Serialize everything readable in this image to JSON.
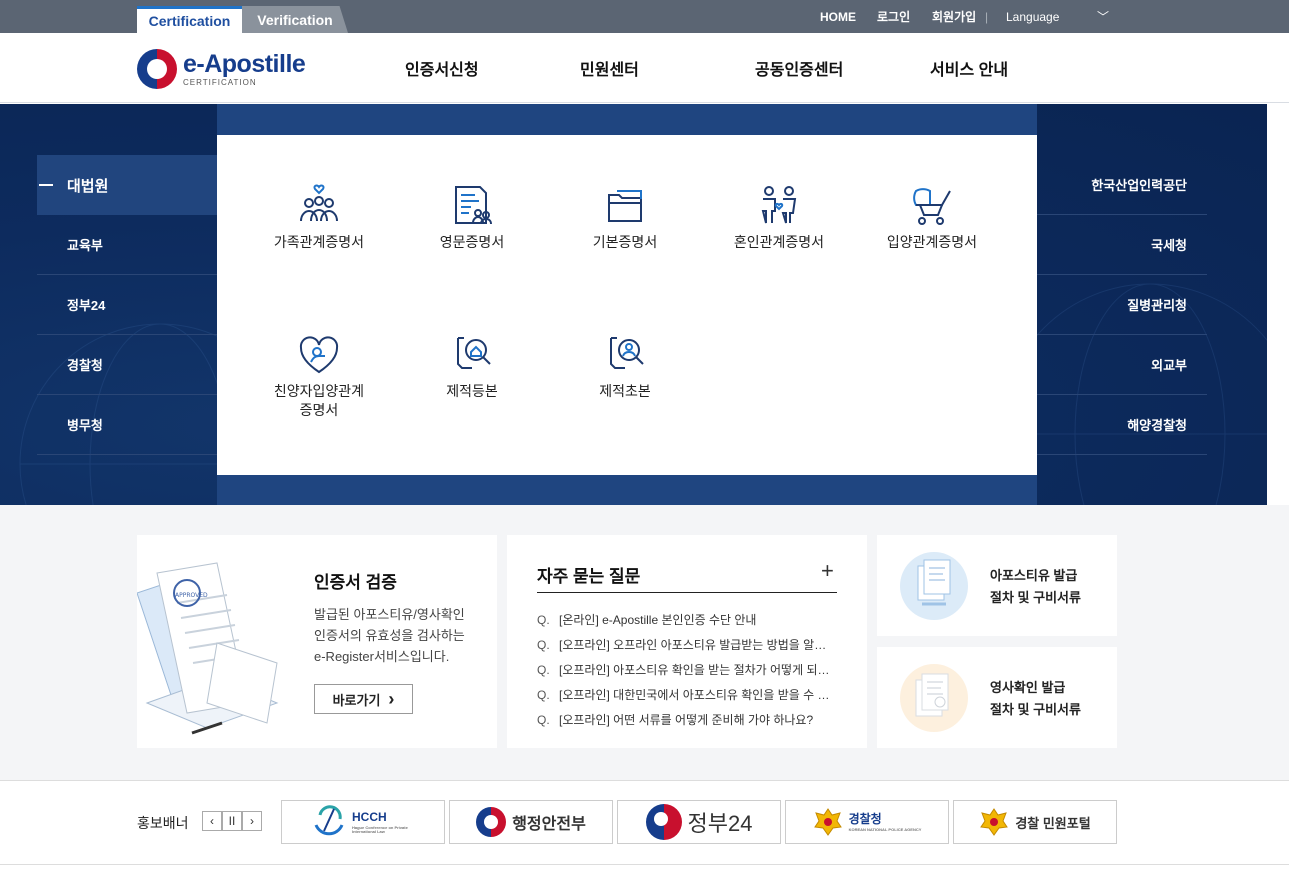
{
  "top_tabs": {
    "certification": "Certification",
    "verification": "Verification"
  },
  "utility": {
    "home": "HOME",
    "login": "로그인",
    "join": "회원가입",
    "separator": "|",
    "language": "Language",
    "caret": "﹀"
  },
  "logo": {
    "name": "e-Apostille",
    "sub": "CERTIFICATION"
  },
  "gnb": [
    "인증서신청",
    "민원센터",
    "공동인증센터",
    "서비스 안내"
  ],
  "left_nav": [
    "대법원",
    "교육부",
    "정부24",
    "경찰청",
    "병무청"
  ],
  "right_nav": [
    "한국산업인력공단",
    "국세청",
    "질병관리청",
    "외교부",
    "해양경찰청"
  ],
  "documents": [
    {
      "label": "가족관계증명서",
      "icon": "family-icon"
    },
    {
      "label": "영문증명서",
      "icon": "english-document-icon"
    },
    {
      "label": "기본증명서",
      "icon": "folder-icon"
    },
    {
      "label": "혼인관계증명서",
      "icon": "couple-icon"
    },
    {
      "label": "입양관계증명서",
      "icon": "stroller-icon"
    },
    {
      "label_line1": "친양자입양관계",
      "label_line2": "증명서",
      "icon": "heart-child-icon"
    },
    {
      "label": "제적등본",
      "icon": "house-search-icon"
    },
    {
      "label": "제적초본",
      "icon": "person-search-icon"
    }
  ],
  "verify": {
    "title": "인증서 검증",
    "desc_line1": "발급된 아포스티유/영사확인",
    "desc_line2": "인증서의 유효성을 검사하는",
    "desc_line3": "e-Register서비스입니다.",
    "button": "바로가기",
    "button_arrow": "›",
    "stamp": "APPROVED"
  },
  "faq": {
    "title": "자주 묻는 질문",
    "more": "+",
    "q_mark": "Q.",
    "items": [
      "[온라인] e-Apostille 본인인증 수단 안내",
      "[오프라인] 오프라인 아포스티유 발급받는 방법을 알려주세요",
      "[오프라인] 아포스티유 확인을 받는 절차가 어떻게 되나요?",
      "[오프라인] 대한민국에서 아포스티유 확인을 받을 수 있나요?",
      "[오프라인] 어떤 서류를 어떻게 준비해 가야 하나요?"
    ]
  },
  "guides": [
    {
      "line1": "아포스티유 발급",
      "line2": "절차 및 구비서류",
      "color": "#dcebf8"
    },
    {
      "line1": "영사확인 발급",
      "line2": "절차 및 구비서류",
      "color": "#fdf0de"
    }
  ],
  "banner": {
    "label": "홍보배너",
    "prev": "‹",
    "pause": "II",
    "next": "›",
    "items": [
      "HCCH",
      "행정안전부",
      "정부24",
      "경찰청",
      "경찰 민원포털"
    ],
    "hcch_sub": "Hague Conference on Private International Law",
    "police_sub": "KOREAN NATIONAL POLICE AGENCY"
  },
  "colors": {
    "navy": "#0d2b5e",
    "panel_frame": "#1f4580",
    "accent": "#1f73c9",
    "topbar": "#5b6573"
  }
}
